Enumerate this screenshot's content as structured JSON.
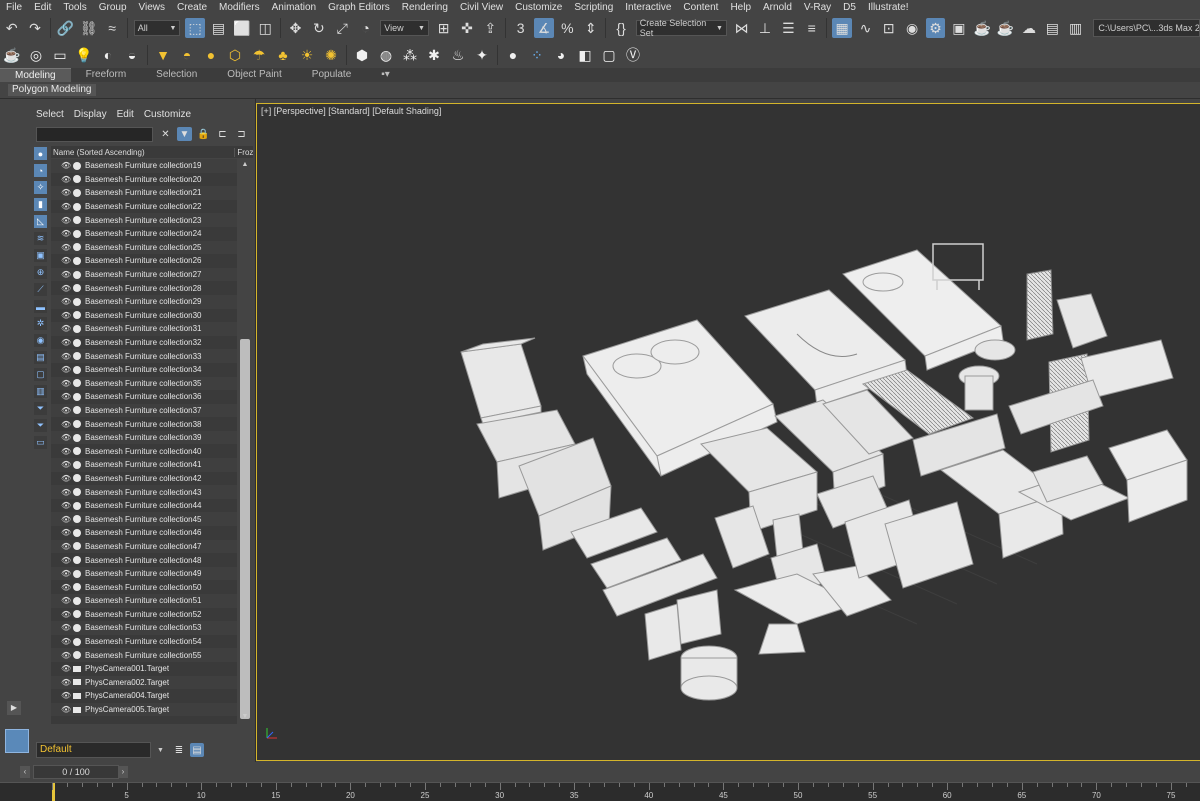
{
  "menu": [
    "File",
    "Edit",
    "Tools",
    "Group",
    "Views",
    "Create",
    "Modifiers",
    "Animation",
    "Graph Editors",
    "Rendering",
    "Civil View",
    "Customize",
    "Scripting",
    "Interactive",
    "Content",
    "Help",
    "Arnold",
    "V-Ray",
    "D5",
    "Illustrate!"
  ],
  "toolbar": {
    "filter_value": "All",
    "view_value": "View",
    "selection_set": "Create Selection Set",
    "path": "C:\\Users\\PC\\...3ds Max 2"
  },
  "ribbon": {
    "tabs": [
      "Modeling",
      "Freeform",
      "Selection",
      "Object Paint",
      "Populate"
    ],
    "panel_label": "Polygon Modeling"
  },
  "explorer": {
    "menu": [
      "Select",
      "Display",
      "Edit",
      "Customize"
    ],
    "column_name": "Name (Sorted Ascending)",
    "column_frozen": "Froz",
    "items": [
      {
        "name": "Basemesh Furniture collection19",
        "kind": "geo"
      },
      {
        "name": "Basemesh Furniture collection20",
        "kind": "geo"
      },
      {
        "name": "Basemesh Furniture collection21",
        "kind": "geo"
      },
      {
        "name": "Basemesh Furniture collection22",
        "kind": "geo"
      },
      {
        "name": "Basemesh Furniture collection23",
        "kind": "geo"
      },
      {
        "name": "Basemesh Furniture collection24",
        "kind": "geo"
      },
      {
        "name": "Basemesh Furniture collection25",
        "kind": "geo"
      },
      {
        "name": "Basemesh Furniture collection26",
        "kind": "geo"
      },
      {
        "name": "Basemesh Furniture collection27",
        "kind": "geo"
      },
      {
        "name": "Basemesh Furniture collection28",
        "kind": "geo"
      },
      {
        "name": "Basemesh Furniture collection29",
        "kind": "geo"
      },
      {
        "name": "Basemesh Furniture collection30",
        "kind": "geo"
      },
      {
        "name": "Basemesh Furniture collection31",
        "kind": "geo"
      },
      {
        "name": "Basemesh Furniture collection32",
        "kind": "geo"
      },
      {
        "name": "Basemesh Furniture collection33",
        "kind": "geo"
      },
      {
        "name": "Basemesh Furniture collection34",
        "kind": "geo"
      },
      {
        "name": "Basemesh Furniture collection35",
        "kind": "geo"
      },
      {
        "name": "Basemesh Furniture collection36",
        "kind": "geo"
      },
      {
        "name": "Basemesh Furniture collection37",
        "kind": "geo"
      },
      {
        "name": "Basemesh Furniture collection38",
        "kind": "geo"
      },
      {
        "name": "Basemesh Furniture collection39",
        "kind": "geo"
      },
      {
        "name": "Basemesh Furniture collection40",
        "kind": "geo"
      },
      {
        "name": "Basemesh Furniture collection41",
        "kind": "geo"
      },
      {
        "name": "Basemesh Furniture collection42",
        "kind": "geo"
      },
      {
        "name": "Basemesh Furniture collection43",
        "kind": "geo"
      },
      {
        "name": "Basemesh Furniture collection44",
        "kind": "geo"
      },
      {
        "name": "Basemesh Furniture collection45",
        "kind": "geo"
      },
      {
        "name": "Basemesh Furniture collection46",
        "kind": "geo"
      },
      {
        "name": "Basemesh Furniture collection47",
        "kind": "geo"
      },
      {
        "name": "Basemesh Furniture collection48",
        "kind": "geo"
      },
      {
        "name": "Basemesh Furniture collection49",
        "kind": "geo"
      },
      {
        "name": "Basemesh Furniture collection50",
        "kind": "geo"
      },
      {
        "name": "Basemesh Furniture collection51",
        "kind": "geo"
      },
      {
        "name": "Basemesh Furniture collection52",
        "kind": "geo"
      },
      {
        "name": "Basemesh Furniture collection53",
        "kind": "geo"
      },
      {
        "name": "Basemesh Furniture collection54",
        "kind": "geo"
      },
      {
        "name": "Basemesh Furniture collection55",
        "kind": "geo"
      },
      {
        "name": "PhysCamera001.Target",
        "kind": "cam"
      },
      {
        "name": "PhysCamera002.Target",
        "kind": "cam"
      },
      {
        "name": "PhysCamera004.Target",
        "kind": "cam"
      },
      {
        "name": "PhysCamera005.Target",
        "kind": "cam"
      }
    ],
    "layer": "Default"
  },
  "viewport": {
    "label": "[+] [Perspective] [Standard] [Default Shading]"
  },
  "timeline": {
    "frame_counter": "0 / 100",
    "ticks": [
      "0",
      "5",
      "10",
      "15",
      "20",
      "25",
      "30",
      "35",
      "40",
      "45",
      "50",
      "55",
      "60",
      "65",
      "70",
      "75"
    ]
  },
  "colors": {
    "viewport_border": "#d4b52b",
    "active_button": "#5b87b5",
    "layer_text": "#f2c232"
  }
}
